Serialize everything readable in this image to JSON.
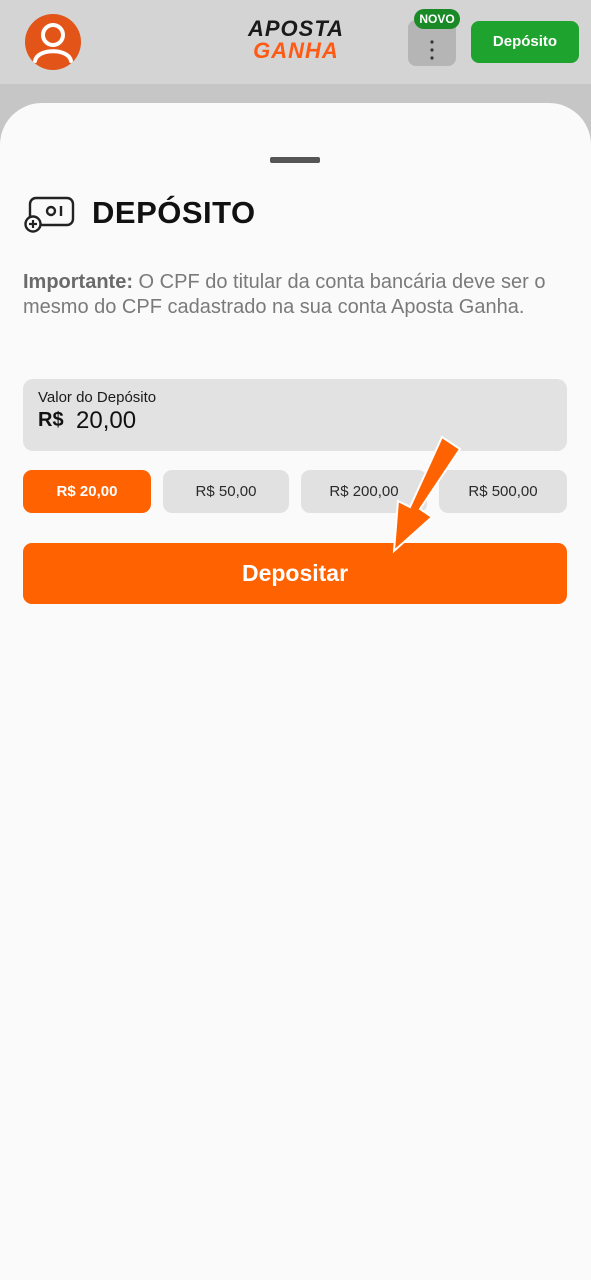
{
  "header": {
    "logo_line1": "APOSTA",
    "logo_line2": "GANHA",
    "menu_dots": "⋮",
    "novo_badge": "NOVO",
    "deposit_button": "Depósito",
    "avatar_icon": "user-icon"
  },
  "sheet": {
    "title": "DEPÓSITO",
    "title_icon": "gamepad-icon",
    "notice_bold": "Importante:",
    "notice_text": " O CPF do titular da conta bancária deve ser o mesmo do CPF cadastrado na sua conta Aposta Ganha.",
    "amount": {
      "label": "Valor do Depósito",
      "currency": "R$",
      "value": "20,00"
    },
    "quick_amounts": [
      {
        "label": "R$ 20,00",
        "selected": true
      },
      {
        "label": "R$ 50,00",
        "selected": false
      },
      {
        "label": "R$ 200,00",
        "selected": false
      },
      {
        "label": "R$ 500,00",
        "selected": false
      }
    ],
    "submit_button": "Depositar"
  },
  "colors": {
    "accent_orange": "#ff6200",
    "header_green": "#1ea32e",
    "avatar_orange": "#e25418"
  }
}
